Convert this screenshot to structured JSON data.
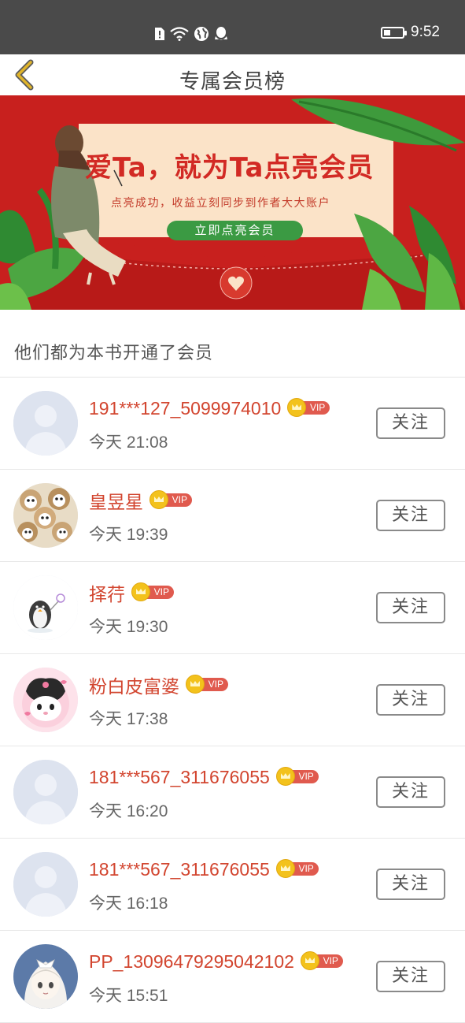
{
  "status_bar": {
    "time": "9:52",
    "icons": [
      "sim-alert-icon",
      "wifi-icon",
      "globe-icon",
      "qq-icon"
    ],
    "battery_level": 0.35
  },
  "header": {
    "title": "专属会员榜",
    "back_icon": "chevron-left-icon",
    "back_color": "#e0b42a"
  },
  "banner": {
    "headline": "爱Ta，就为Ta点亮会员",
    "subline": "点亮成功，收益立刻同步到作者大大账户",
    "cta": "立即点亮会员",
    "colors": {
      "background": "#c8201e",
      "card": "#fbe3c8",
      "cta": "#3b9a43"
    }
  },
  "section": {
    "title": "他们都为本书开通了会员"
  },
  "vip_label": "VIP",
  "follow_label": "关注",
  "members": [
    {
      "name": "191***127_5099974010",
      "time": "今天 21:08",
      "avatar": "default-avatar"
    },
    {
      "name": "皇昱星",
      "time": "今天 19:39",
      "avatar": "plush-bears-avatar"
    },
    {
      "name": "择荇",
      "time": "今天 19:30",
      "avatar": "penguin-avatar"
    },
    {
      "name": "粉白皮富婆",
      "time": "今天 17:38",
      "avatar": "kuromi-avatar"
    },
    {
      "name": "181***567_311676055",
      "time": "今天 16:20",
      "avatar": "default-avatar"
    },
    {
      "name": "181***567_311676055",
      "time": "今天 16:18",
      "avatar": "default-avatar"
    },
    {
      "name": "PP_13096479295042102",
      "time": "今天 15:51",
      "avatar": "anime-girl-avatar"
    }
  ]
}
